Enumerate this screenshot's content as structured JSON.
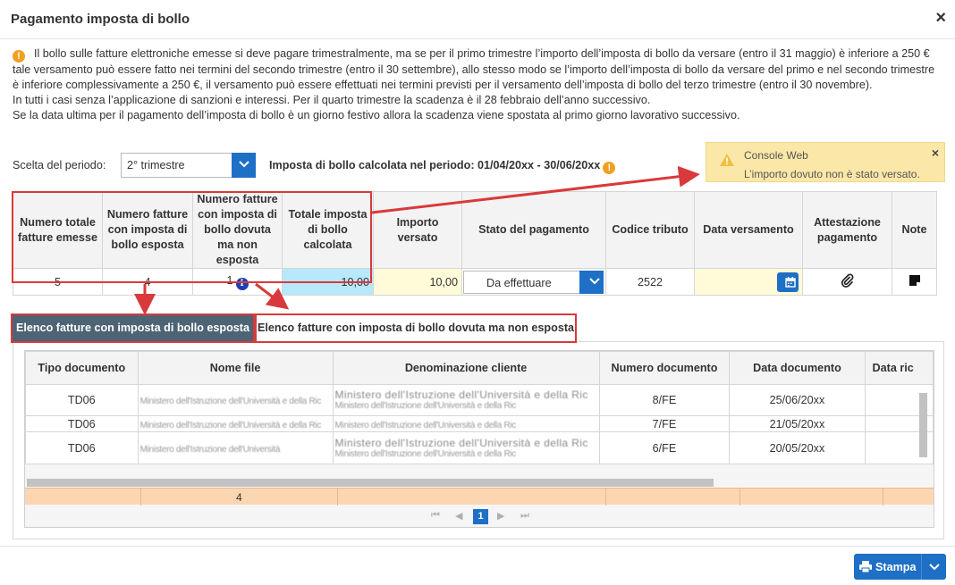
{
  "dialog": {
    "title": "Pagamento imposta di bollo"
  },
  "info": {
    "para1": "Il bollo sulle fatture elettroniche emesse si deve pagare trimestralmente, ma se per il primo trimestre l’importo dell’imposta di bollo da versare (entro il 31 maggio) è inferiore a 250 € tale versamento può essere fatto nei termini del secondo trimestre (entro il 30 settembre), allo stesso modo se l’importo dell’imposta di bollo da versare del primo e nel secondo trimestre è inferiore complessivamente a 250 €, il versamento può essere effettuati nei termini previsti per il versamento dell’imposta di bollo del terzo trimestre (entro il 30 novembre).",
    "para2": "In tutti i casi senza l’applicazione di sanzioni e interessi. Per il quarto trimestre la scadenza è il 28 febbraio dell’anno successivo.",
    "para3": "Se la data ultima per il pagamento dell’imposta di bollo è un giorno festivo allora la scadenza viene spostata al primo giorno lavorativo successivo."
  },
  "period": {
    "label": "Scelta del periodo:",
    "selected": "2° trimestre",
    "calc_text": "Imposta di bollo calcolata nel periodo: 01/04/20xx - 30/06/20xx"
  },
  "toast": {
    "title": "Console Web",
    "message": "L’importo dovuto non è stato versato."
  },
  "summary": {
    "headers": [
      "Numero totale fatture emesse",
      "Numero fatture con imposta di bollo esposta",
      "Numero fatture con imposta di bollo dovuta ma non esposta",
      "Totale imposta di bollo calcolata",
      "Importo versato",
      "Stato del pagamento",
      "Codice tributo",
      "Data versamento",
      "Attestazione pagamento",
      "Note"
    ],
    "row": {
      "totale": "5",
      "esposta": "4",
      "non_esposta": "1",
      "totale_imposta": "10,00",
      "importo_versato": "10,00",
      "stato": "Da effettuare",
      "codice_tributo": "2522",
      "data_versamento": ""
    }
  },
  "tabs": [
    {
      "label": "Elenco fatture con imposta di bollo esposta"
    },
    {
      "label": "Elenco fatture con imposta di bollo dovuta ma non esposta"
    }
  ],
  "grid": {
    "columns": [
      "Tipo documento",
      "Nome file",
      "Denominazione cliente",
      "Numero documento",
      "Data documento",
      "Data ric"
    ],
    "rows": [
      {
        "tipo": "TD06",
        "file": "Ministero dell'Istruzione dell'Università e della Ric",
        "cliente1": "Ministero dell'Istruzione dell'Università e della Ric",
        "cliente2": "Ministero dell'Istruzione dell'Università e della Ric",
        "numero": "8/FE",
        "data": "25/06/20xx"
      },
      {
        "tipo": "TD06",
        "file": "Ministero dell'Istruzione dell'Università e della Ric",
        "cliente1": "Ministero dell'Istruzione dell'Università e della Ric",
        "cliente2": "",
        "numero": "7/FE",
        "data": "21/05/20xx"
      },
      {
        "tipo": "TD06",
        "file": "Ministero dell'Istruzione dell'Università",
        "cliente1": "Ministero dell'Istruzione dell'Università e della Ric",
        "cliente2": "Ministero dell'Istruzione dell'Università e della Ric",
        "numero": "6/FE",
        "data": "20/05/20xx"
      }
    ],
    "total": "4",
    "page": "1"
  },
  "footer": {
    "print_label": "Stampa"
  },
  "colors": {
    "accent": "#1e6fc6",
    "highlight": "#d9393b",
    "tab_active": "#4d6475"
  },
  "icons": [
    "close-icon",
    "info-icon",
    "chevron-down-icon",
    "warning-icon",
    "calendar-icon",
    "paperclip-icon",
    "note-icon",
    "printer-icon"
  ]
}
